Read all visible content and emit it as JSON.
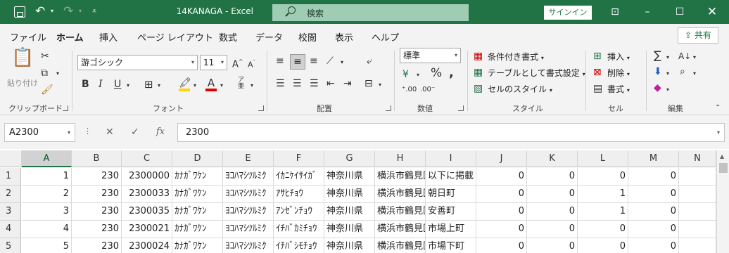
{
  "window": {
    "title": "14KANAGA  -  Excel",
    "search_label": "検索",
    "signin_label": "サインイン",
    "share_label": "共有"
  },
  "ribbon_tabs": [
    "ファイル",
    "ホーム",
    "挿入",
    "ページ レイアウト",
    "数式",
    "データ",
    "校閲",
    "表示",
    "ヘルプ"
  ],
  "ribbon": {
    "paste_label": "貼り付け",
    "clipboard_group": "クリップボード",
    "font_name": "游ゴシック",
    "font_size": "11",
    "font_group": "フォント",
    "align_group": "配置",
    "number_format": "標準",
    "number_group": "数値",
    "cond_format_label": "条件付き書式",
    "table_format_label": "テーブルとして書式設定",
    "cell_style_label": "セルのスタイル",
    "style_group": "スタイル",
    "insert_label": "挿入",
    "delete_label": "削除",
    "format_label": "書式",
    "cells_group": "セル",
    "edit_group": "編集"
  },
  "formula_bar": {
    "name_box": "A2300",
    "formula": "2300"
  },
  "columns": [
    "A",
    "B",
    "C",
    "D",
    "E",
    "F",
    "G",
    "H",
    "I",
    "J",
    "K",
    "L",
    "M",
    "N"
  ],
  "rows": [
    {
      "num": "1",
      "cells": [
        "1",
        "230",
        "2300000",
        "ｶﾅｶﾞﾜｹﾝ",
        "ﾖｺﾊﾏｼﾂﾙﾐｸ",
        "ｲｶﾆｹｲｻｲｶﾞ",
        "神奈川県",
        "横浜市鶴見区",
        "以下に掲載",
        "0",
        "0",
        "0",
        "0",
        ""
      ]
    },
    {
      "num": "2",
      "cells": [
        "2",
        "230",
        "2300033",
        "ｶﾅｶﾞﾜｹﾝ",
        "ﾖｺﾊﾏｼﾂﾙﾐｸ",
        "ｱｻﾋﾁｮｳ",
        "神奈川県",
        "横浜市鶴見区",
        "朝日町",
        "0",
        "0",
        "1",
        "0",
        ""
      ]
    },
    {
      "num": "3",
      "cells": [
        "3",
        "230",
        "2300035",
        "ｶﾅｶﾞﾜｹﾝ",
        "ﾖｺﾊﾏｼﾂﾙﾐｸ",
        "ｱﾝｾﾞﾝﾁｮｳ",
        "神奈川県",
        "横浜市鶴見区",
        "安善町",
        "0",
        "0",
        "1",
        "0",
        ""
      ]
    },
    {
      "num": "4",
      "cells": [
        "4",
        "230",
        "2300021",
        "ｶﾅｶﾞﾜｹﾝ",
        "ﾖｺﾊﾏｼﾂﾙﾐｸ",
        "ｲﾁﾊﾞｶﾐﾁｮｳ",
        "神奈川県",
        "横浜市鶴見区",
        "市場上町",
        "0",
        "0",
        "0",
        "0",
        ""
      ]
    },
    {
      "num": "5",
      "cells": [
        "5",
        "230",
        "2300024",
        "ｶﾅｶﾞﾜｹﾝ",
        "ﾖｺﾊﾏｼﾂﾙﾐｸ",
        "ｲﾁﾊﾞｼﾓﾁｮｳ",
        "神奈川県",
        "横浜市鶴見区",
        "市場下町",
        "0",
        "0",
        "0",
        "0",
        ""
      ]
    }
  ],
  "colors": {
    "accent": "#217346",
    "search_bg": "#9fcdb3"
  }
}
